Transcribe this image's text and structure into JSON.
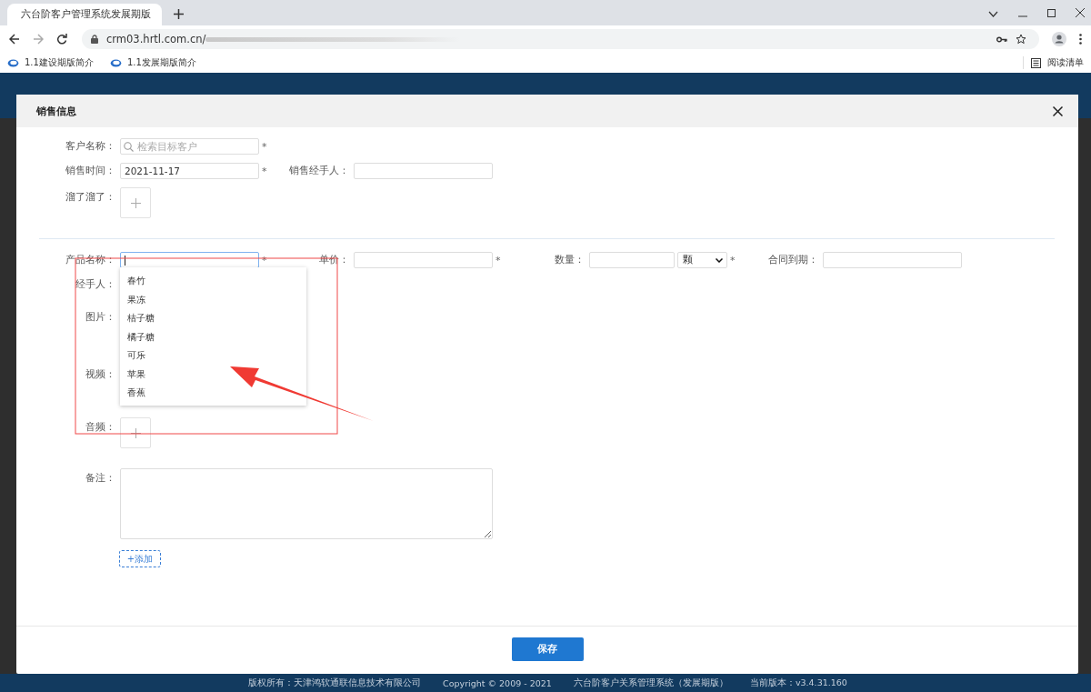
{
  "browser": {
    "tab_title": "六台阶客户管理系统发展期版",
    "url": "crm03.hrtl.com.cn/",
    "bookmarks": [
      "1.1建设期版简介",
      "1.1发展期版简介"
    ],
    "reading_list": "阅读清单"
  },
  "dialog": {
    "title": "销售信息",
    "customer": {
      "label": "客户名称：",
      "placeholder": "检索目标客户",
      "mark": "*"
    },
    "sale_date": {
      "label": "销售时间：",
      "value": "2021-11-17",
      "mark": "*"
    },
    "sales_handler": {
      "label": "销售经手人："
    },
    "attachment": {
      "label": "溜了溜了："
    },
    "product_fields": [
      {
        "kind": "text",
        "label": "产品名称：",
        "focused": true,
        "mark": "*"
      },
      {
        "kind": "text",
        "label": "单价：",
        "focused": false,
        "mark": "*"
      },
      {
        "kind": "quantity",
        "label": "数量：",
        "unit": "颗",
        "focused": false,
        "mark": "*"
      },
      {
        "kind": "text",
        "label": "合同到期：",
        "focused": false
      }
    ],
    "suggestions": [
      "春竹",
      "果冻",
      "桔子糖",
      "橘子糖",
      "可乐",
      "苹果",
      "香蕉"
    ],
    "handler_label": "经手人：",
    "image_label": "图片：",
    "video_label": "视频：",
    "audio_label": "音频：",
    "notes_label": "备注：",
    "add_button": "+添加",
    "save_button": "保存"
  },
  "footer": [
    "版权所有：天津鸿软通联信息技术有限公司",
    "Copyright © 2009 - 2021",
    "六台阶客户关系管理系统（发展期版）",
    "当前版本：v3.4.31.160"
  ]
}
